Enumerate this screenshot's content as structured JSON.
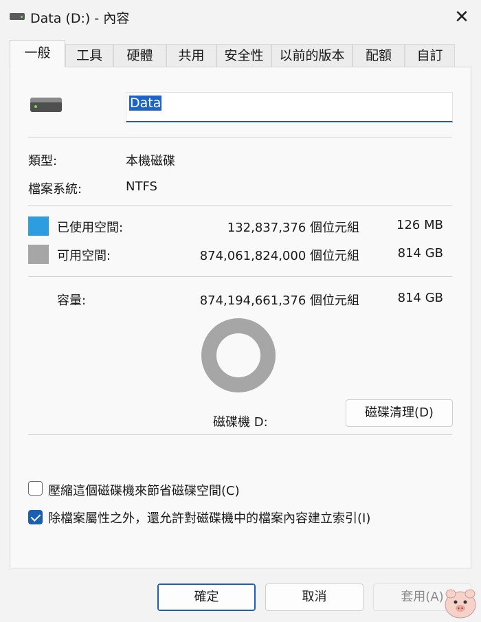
{
  "window": {
    "title": "Data (D:) - 內容",
    "close": "✕"
  },
  "tabs": [
    {
      "label": "一般"
    },
    {
      "label": "工具"
    },
    {
      "label": "硬體"
    },
    {
      "label": "共用"
    },
    {
      "label": "安全性"
    },
    {
      "label": "以前的版本"
    },
    {
      "label": "配額"
    },
    {
      "label": "自訂"
    }
  ],
  "active_tab": "一般",
  "drive": {
    "name_value": "Data",
    "icon": "drive-icon"
  },
  "info": {
    "type_label": "類型:",
    "type_value": "本機磁碟",
    "fs_label": "檔案系統:",
    "fs_value": "NTFS"
  },
  "space": {
    "used": {
      "label": "已使用空間:",
      "bytes": "132,837,376 個位元組",
      "size": "126 MB",
      "color": "#2b9de0"
    },
    "free": {
      "label": "可用空間:",
      "bytes": "874,061,824,000 個位元組",
      "size": "814 GB",
      "color": "#a6a6a6"
    },
    "capacity": {
      "label": "容量:",
      "bytes": "874,194,661,376 個位元組",
      "size": "814 GB"
    },
    "used_fraction": 0.00015
  },
  "disk_label": "磁碟機 D:",
  "cleanup_button": "磁碟清理(D)",
  "options": {
    "compress": {
      "label": "壓縮這個磁碟機來節省磁碟空間(C)",
      "checked": false
    },
    "index": {
      "label": "除檔案屬性之外，還允許對磁碟機中的檔案內容建立索引(I)",
      "checked": true
    }
  },
  "buttons": {
    "ok": "確定",
    "cancel": "取消",
    "apply": "套用(A)"
  }
}
